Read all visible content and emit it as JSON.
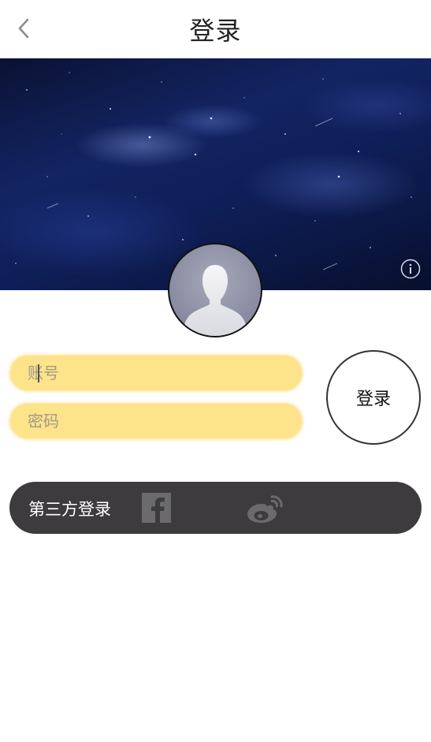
{
  "header": {
    "title": "登录",
    "back_icon": "chevron-left-icon"
  },
  "banner": {
    "image": "starry-night-sky",
    "info_icon": "info-circle-icon"
  },
  "avatar": {
    "icon": "default-user-avatar-icon"
  },
  "form": {
    "account_placeholder": "账号",
    "account_value": "",
    "password_placeholder": "密码",
    "password_value": "",
    "login_label": "登录"
  },
  "third_party": {
    "label": "第三方登录",
    "providers": [
      {
        "icon": "facebook-icon"
      },
      {
        "icon": "weibo-icon"
      }
    ]
  },
  "colors": {
    "input_fill": "#fde38a",
    "third_bar": "#3d3b3e",
    "banner_dark": "#0b1743"
  }
}
